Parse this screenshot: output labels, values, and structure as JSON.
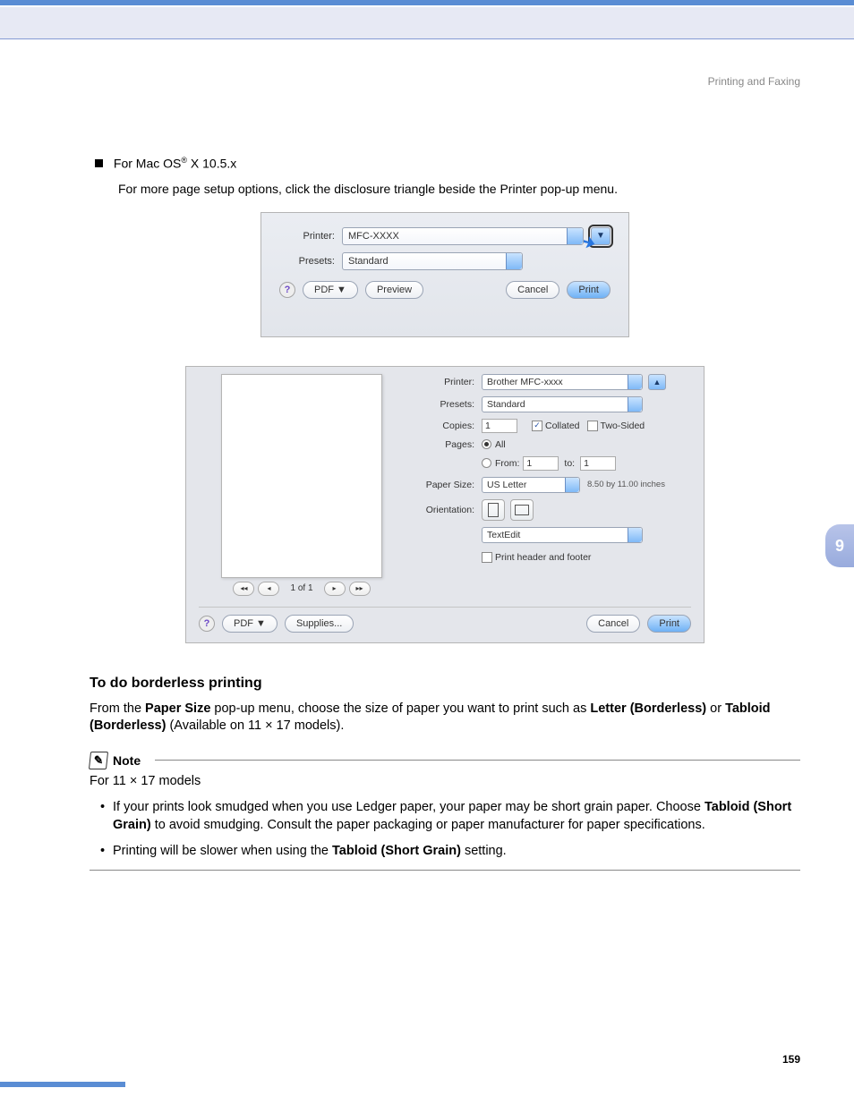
{
  "header": {
    "breadcrumb": "Printing and Faxing"
  },
  "section": {
    "bullet_pre": "For Mac OS",
    "bullet_reg": "®",
    "bullet_post": " X 10.5.x",
    "sub": "For more page setup options, click the disclosure triangle beside the Printer pop-up menu."
  },
  "shot1": {
    "printer_label": "Printer:",
    "printer_value": "MFC-XXXX",
    "presets_label": "Presets:",
    "presets_value": "Standard",
    "help": "?",
    "pdf": "PDF ▼",
    "preview": "Preview",
    "cancel": "Cancel",
    "print": "Print",
    "disclosure": "▼"
  },
  "shot2": {
    "printer_label": "Printer:",
    "printer_value": "Brother MFC-xxxx",
    "presets_label": "Presets:",
    "presets_value": "Standard",
    "copies_label": "Copies:",
    "copies_value": "1",
    "collated": "Collated",
    "twosided": "Two-Sided",
    "pages_label": "Pages:",
    "all": "All",
    "from": "From:",
    "from_value": "1",
    "to": "to:",
    "to_value": "1",
    "papersize_label": "Paper Size:",
    "papersize_value": "US Letter",
    "papersize_dim": "8.50 by 11.00 inches",
    "orientation_label": "Orientation:",
    "pane_value": "TextEdit",
    "print_header": "Print header and footer",
    "nav_count": "1 of 1",
    "help": "?",
    "pdf": "PDF ▼",
    "supplies": "Supplies...",
    "cancel": "Cancel",
    "print": "Print",
    "collapse": "▲"
  },
  "body": {
    "h3": "To do borderless printing",
    "p1_a": "From the ",
    "p1_b": "Paper Size",
    "p1_c": " pop-up menu, choose the size of paper you want to print such as ",
    "p1_d": "Letter (Borderless)",
    "p1_e": " or ",
    "p1_f": "Tabloid (Borderless)",
    "p1_g": " (Available on 11 × 17 models).",
    "note_label": "Note",
    "note_sub": "For 11 × 17 models",
    "li1_a": "If your prints look smudged when you use Ledger paper, your paper may be short grain paper. Choose ",
    "li1_b": "Tabloid (Short Grain)",
    "li1_c": " to avoid smudging. Consult the paper packaging or paper manufacturer for paper specifications.",
    "li2_a": "Printing will be slower when using the ",
    "li2_b": "Tabloid (Short Grain)",
    "li2_c": " setting."
  },
  "side_tab": "9",
  "page_number": "159"
}
